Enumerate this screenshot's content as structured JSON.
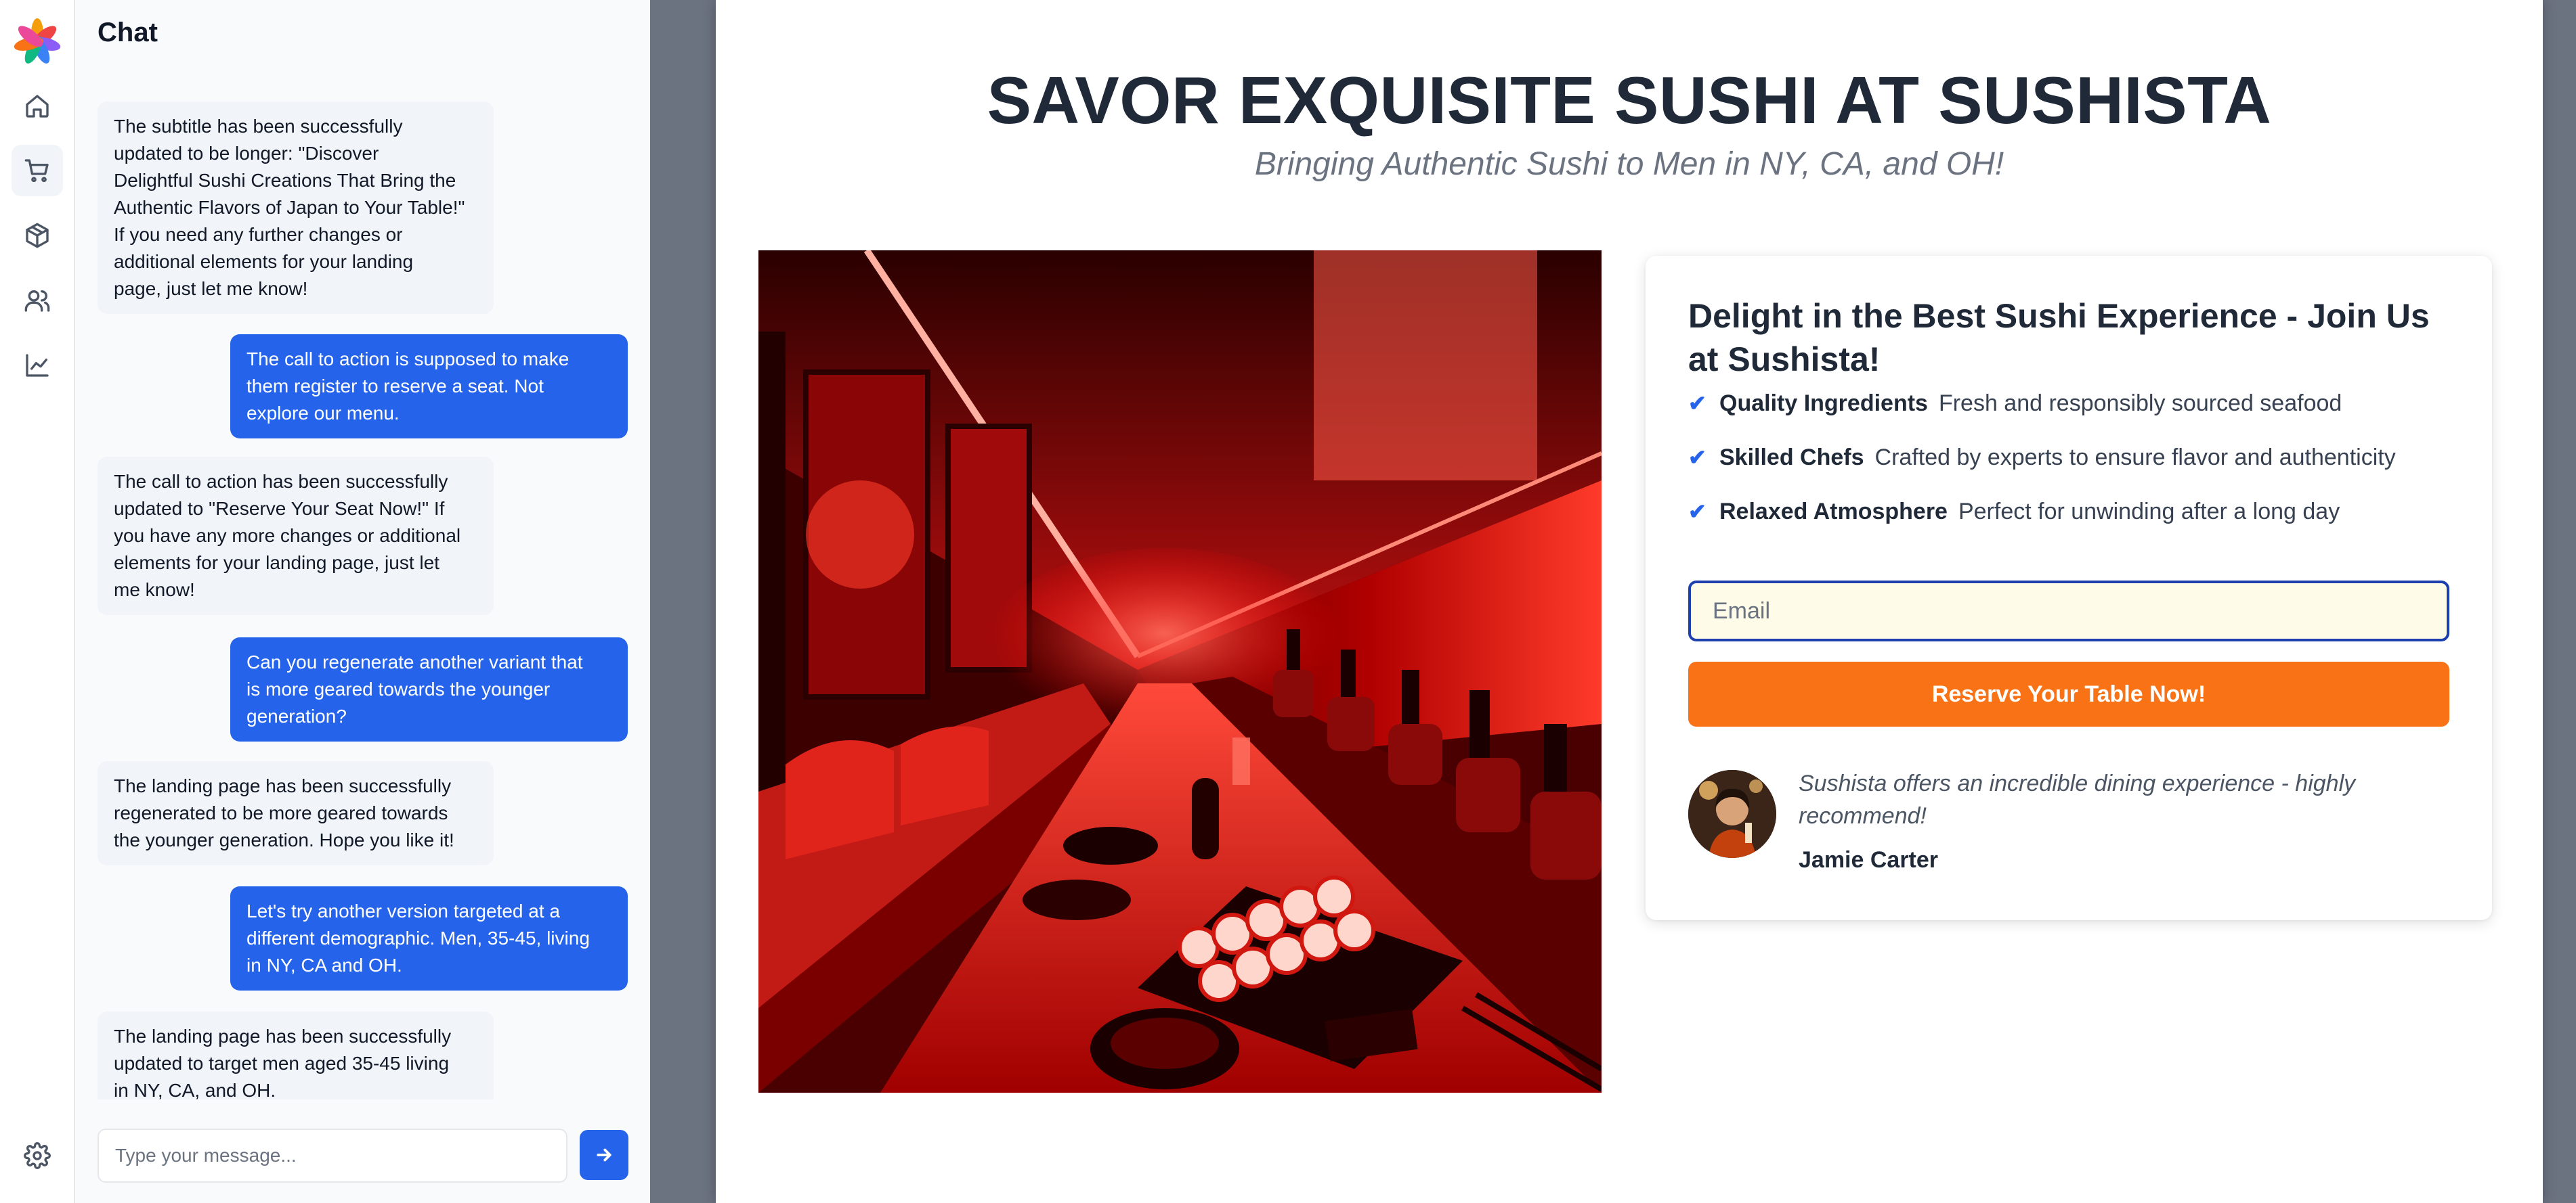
{
  "app": {
    "colors": {
      "accent": "#2563eb",
      "cta": "#f97316",
      "preview_bg": "#6b7280"
    }
  },
  "sidebar": {
    "items": [
      {
        "name": "home",
        "icon": "home-icon"
      },
      {
        "name": "cart",
        "icon": "shopping-cart-icon",
        "active": true
      },
      {
        "name": "products",
        "icon": "box-icon"
      },
      {
        "name": "users",
        "icon": "users-icon"
      },
      {
        "name": "analytics",
        "icon": "chart-line-icon"
      }
    ],
    "settings_icon": "gear-icon"
  },
  "chat": {
    "title": "Chat",
    "messages": [
      {
        "role": "assistant",
        "text": "The subtitle has been successfully\nupdated to be longer: \"Discover\nDelightful Sushi Creations That Bring the\nAuthentic Flavors of Japan to Your Table!\"\nIf you need any further changes or\nadditional elements for your landing\npage, just let me know!"
      },
      {
        "role": "user",
        "text": "The call to action is supposed to make\nthem register to reserve a seat. Not\nexplore our menu."
      },
      {
        "role": "assistant",
        "text": "The call to action has been successfully\nupdated to \"Reserve Your Seat Now!\" If\nyou have any more changes or additional\nelements for your landing page, just let\nme know!"
      },
      {
        "role": "user",
        "text": "Can you regenerate another variant that\nis more geared towards the younger\ngeneration?"
      },
      {
        "role": "assistant",
        "text": "The landing page has been successfully\nregenerated to be more geared towards\nthe younger generation. Hope you like it!"
      },
      {
        "role": "user",
        "text": "Let's try another version targeted at a\ndifferent demographic. Men, 35-45, living\nin NY, CA and OH."
      },
      {
        "role": "assistant",
        "text": "The landing page has been successfully\nupdated to target men aged 35-45 living\nin NY, CA, and OH."
      }
    ],
    "input_placeholder": "Type your message...",
    "send_icon": "arrow-right-icon"
  },
  "landing": {
    "headline": "SAVOR EXQUISITE SUSHI AT SUSHISTA",
    "subtitle": "Bringing Authentic Sushi to Men in NY, CA, and OH!",
    "card": {
      "title": "Delight in the Best Sushi Experience - Join Us at Sushista!",
      "features": [
        {
          "name": "Quality Ingredients",
          "desc": "Fresh and responsibly sourced seafood"
        },
        {
          "name": "Skilled Chefs",
          "desc": "Crafted by experts to ensure flavor and authenticity"
        },
        {
          "name": "Relaxed Atmosphere",
          "desc": "Perfect for unwinding after a long day"
        }
      ],
      "check_glyph": "✔",
      "email_placeholder": "Email",
      "cta_label": "Reserve Your Table Now!",
      "testimonial": {
        "quote": "Sushista offers an incredible dining experience - highly recommend!",
        "author": "Jamie Carter"
      }
    }
  }
}
